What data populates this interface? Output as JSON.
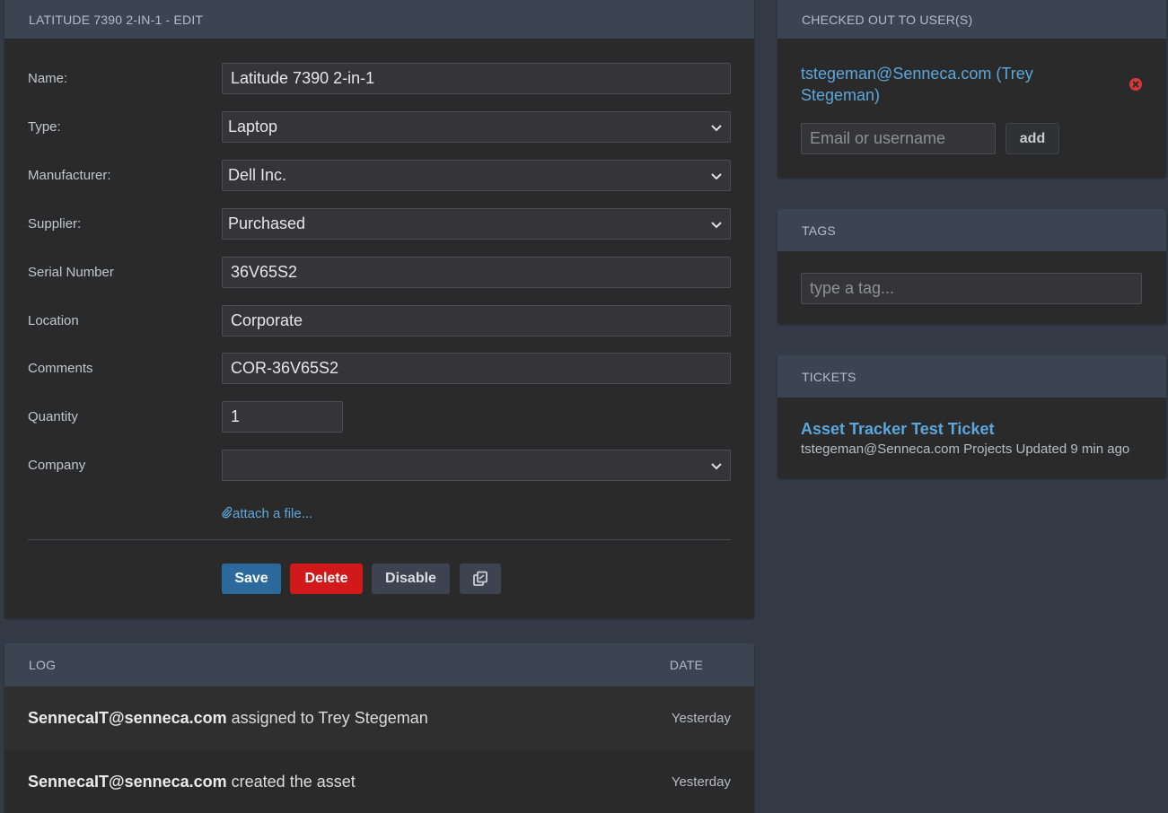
{
  "edit": {
    "title": "LATITUDE 7390 2-IN-1 - EDIT",
    "fields": {
      "name": {
        "label": "Name:",
        "value": "Latitude 7390 2-in-1"
      },
      "type": {
        "label": "Type:",
        "value": "Laptop"
      },
      "manufacturer": {
        "label": "Manufacturer:",
        "value": "Dell Inc."
      },
      "supplier": {
        "label": "Supplier:",
        "value": "Purchased"
      },
      "serial": {
        "label": "Serial Number",
        "value": "36V65S2"
      },
      "location": {
        "label": "Location",
        "value": "Corporate"
      },
      "comments": {
        "label": "Comments",
        "value": "COR-36V65S2"
      },
      "quantity": {
        "label": "Quantity",
        "value": "1"
      },
      "company": {
        "label": "Company",
        "value": ""
      }
    },
    "attach_label": "attach a file...",
    "buttons": {
      "save": "Save",
      "delete": "Delete",
      "disable": "Disable"
    }
  },
  "log": {
    "header_log": "LOG",
    "header_date": "DATE",
    "rows": [
      {
        "user": "SennecaIT@senneca.com",
        "action": " assigned to Trey Stegeman",
        "date": "Yesterday"
      },
      {
        "user": "SennecaIT@senneca.com",
        "action": " created the asset",
        "date": "Yesterday"
      }
    ]
  },
  "checkout": {
    "title": "CHECKED OUT TO USER(S)",
    "user": "tstegeman@Senneca.com (Trey Stegeman)",
    "input_placeholder": "Email or username",
    "add_label": "add"
  },
  "tags": {
    "title": "TAGS",
    "placeholder": "type a tag..."
  },
  "tickets": {
    "title": "TICKETS",
    "items": [
      {
        "title": "Asset Tracker Test Ticket",
        "meta": "tstegeman@Senneca.com Projects Updated 9 min ago"
      }
    ]
  },
  "colors": {
    "background": "#353b46",
    "panel": "#2a2a2b",
    "panel_header": "#3b4552",
    "link": "#5ca7dc",
    "save": "#2c6a9e",
    "delete": "#d1181b",
    "remove_icon": "#d9363a"
  }
}
